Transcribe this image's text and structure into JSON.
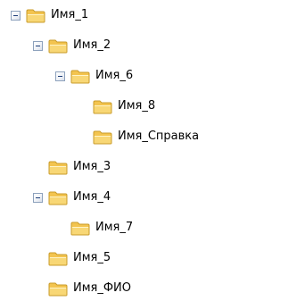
{
  "tree": {
    "nodes": [
      {
        "id": "imya-1",
        "label": "Имя_1",
        "level": 0,
        "expanded": true,
        "has_children": true
      },
      {
        "id": "imya-2",
        "label": "Имя_2",
        "level": 1,
        "expanded": true,
        "has_children": true
      },
      {
        "id": "imya-6",
        "label": "Имя_6",
        "level": 2,
        "expanded": true,
        "has_children": true
      },
      {
        "id": "imya-8",
        "label": "Имя_8",
        "level": 3,
        "expanded": false,
        "has_children": false
      },
      {
        "id": "imya-spravka",
        "label": "Имя_Справка",
        "level": 3,
        "expanded": false,
        "has_children": false
      },
      {
        "id": "imya-3",
        "label": "Имя_3",
        "level": 1,
        "expanded": false,
        "has_children": false
      },
      {
        "id": "imya-4",
        "label": "Имя_4",
        "level": 1,
        "expanded": true,
        "has_children": true
      },
      {
        "id": "imya-7",
        "label": "Имя_7",
        "level": 2,
        "expanded": false,
        "has_children": false
      },
      {
        "id": "imya-5",
        "label": "Имя_5",
        "level": 1,
        "expanded": false,
        "has_children": false
      },
      {
        "id": "imya-fio",
        "label": "Имя_ФИО",
        "level": 1,
        "expanded": false,
        "has_children": false
      }
    ]
  },
  "icons": {
    "toggle_expanded": "minus-box-icon",
    "folder": "folder-icon"
  },
  "colors": {
    "folder_fill": "#f8d775",
    "folder_tab": "#f3c44f",
    "folder_stroke": "#c99b2a",
    "toggle_border": "#8ea2bd",
    "toggle_sign": "#1f3f7a",
    "text": "#000000"
  }
}
